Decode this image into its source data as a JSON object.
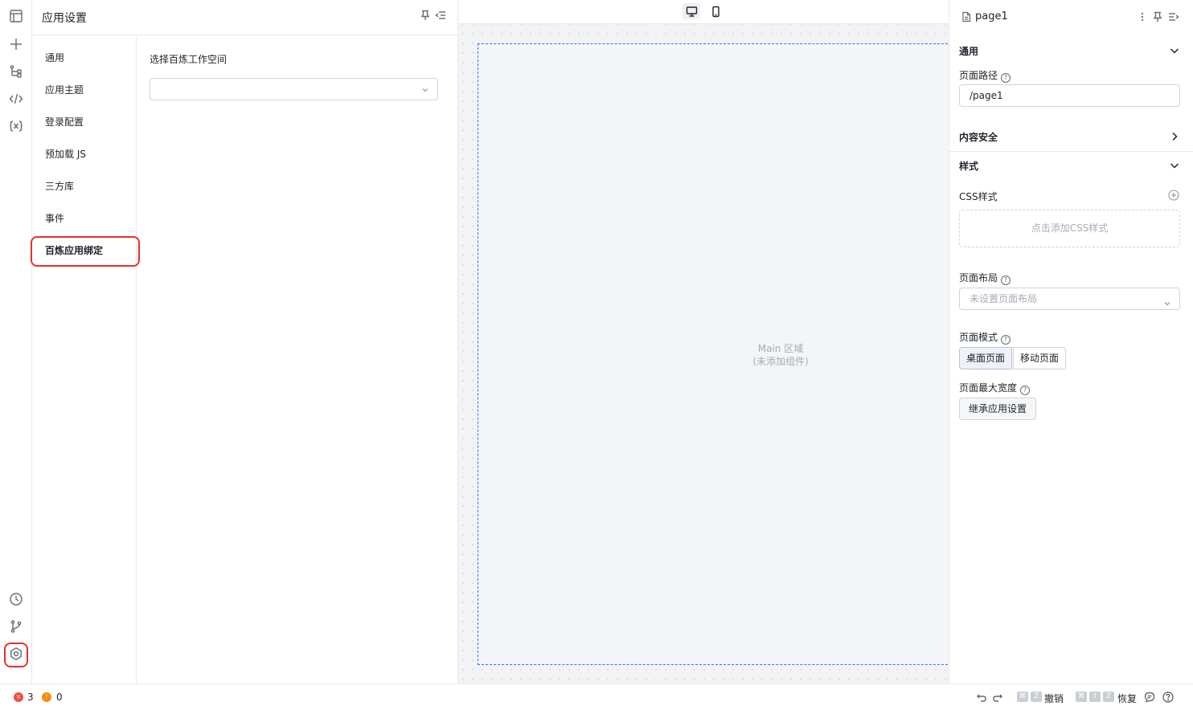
{
  "settings_panel": {
    "title": "应用设置",
    "nav": [
      "通用",
      "应用主题",
      "登录配置",
      "预加载 JS",
      "三方库",
      "事件",
      "百炼应用绑定"
    ],
    "active_index": 6,
    "workspace_label": "选择百炼工作空间",
    "workspace_value": ""
  },
  "canvas": {
    "main_label": "Main 区域",
    "main_sub": "(未添加组件)"
  },
  "props_panel": {
    "page_name": "page1",
    "general_title": "通用",
    "page_path_label": "页面路径",
    "page_path_value": "/page1",
    "content_security_title": "内容安全",
    "style_title": "样式",
    "css_label": "CSS样式",
    "css_add_text": "点击添加CSS样式",
    "layout_label": "页面布局",
    "layout_placeholder": "未设置页面布局",
    "mode_label": "页面模式",
    "mode_options": [
      "桌面页面",
      "移动页面"
    ],
    "mode_selected": "桌面页面",
    "max_width_label": "页面最大宽度",
    "inherit_button": "继承应用设置",
    "help_glyph": "?"
  },
  "status_bar": {
    "error_count": "3",
    "warning_count": "0",
    "error_glyph": "×",
    "warning_glyph": "!",
    "undo_label": "撤销",
    "redo_label": "恢复",
    "key_cmd": "⌘",
    "key_shift": "⇧",
    "key_z": "Z"
  },
  "colors": {
    "accent": "#3370ff",
    "highlight": "#e5312a",
    "error": "#f54a45",
    "warning": "#ff8800"
  }
}
